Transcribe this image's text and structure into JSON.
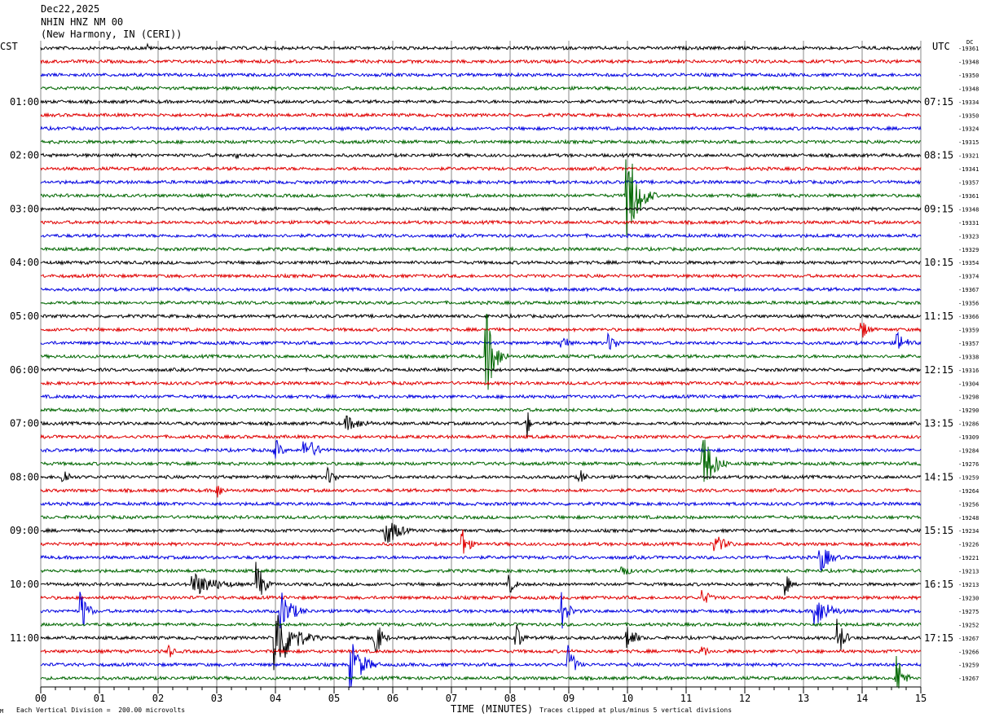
{
  "header": {
    "date": "Dec22,2025",
    "station": "NHIN HNZ NM 00",
    "location": "(New Harmony, IN (CERI))"
  },
  "labels": {
    "left_tz": "CST",
    "right_tz": "UTC",
    "dc_label": "DC",
    "xlabel": "TIME (MINUTES)",
    "scale_note": "Each Vertical Division =  200.00 microvolts",
    "clip_note": "Traces clipped at plus/minus 5 vertical divisions",
    "corner_mark": "M"
  },
  "chart_data": {
    "type": "line",
    "xlabel": "TIME (MINUTES)",
    "xlim": [
      0,
      15
    ],
    "x_ticks": [
      "00",
      "01",
      "02",
      "03",
      "04",
      "05",
      "06",
      "07",
      "08",
      "09",
      "10",
      "11",
      "12",
      "13",
      "14",
      "15"
    ],
    "trace_colors": [
      "#000000",
      "#e00000",
      "#0000e0",
      "#006600"
    ],
    "row_count": 48,
    "cst_labels": [
      "01:00",
      "02:00",
      "03:00",
      "04:00",
      "05:00",
      "06:00",
      "07:00",
      "08:00",
      "09:00",
      "10:00",
      "11:00"
    ],
    "utc_labels": [
      "07:15",
      "08:15",
      "09:15",
      "10:15",
      "11:15",
      "12:15",
      "13:15",
      "14:15",
      "15:15",
      "16:15",
      "17:15"
    ],
    "dc_offsets": [
      "-19361",
      "-19348",
      "-19350",
      "-19348",
      "-19334",
      "-19350",
      "-19324",
      "-19315",
      "-19321",
      "-19341",
      "-19357",
      "-19361",
      "-19348",
      "-19331",
      "-19323",
      "-19329",
      "-19354",
      "-19374",
      "-19367",
      "-19356",
      "-19366",
      "-19359",
      "-19357",
      "-19338",
      "-19316",
      "-19304",
      "-19298",
      "-19290",
      "-19286",
      "-19309",
      "-19284",
      "-19276",
      "-19259",
      "-19264",
      "-19256",
      "-19248",
      "-19234",
      "-19226",
      "-19221",
      "-19213",
      "-19213",
      "-19230",
      "-19275",
      "-19252",
      "-19267",
      "-19266",
      "-19259",
      "-19267"
    ],
    "events": [
      {
        "row": 0,
        "minute": 1.85,
        "amp": 6,
        "dur": 0.1
      },
      {
        "row": 8,
        "minute": 3.35,
        "amp": 6,
        "dur": 0.1
      },
      {
        "row": 11,
        "minute": 10.0,
        "amp": 70,
        "dur": 0.5
      },
      {
        "row": 21,
        "minute": 14.0,
        "amp": 12,
        "dur": 0.4
      },
      {
        "row": 22,
        "minute": 8.9,
        "amp": 12,
        "dur": 0.3
      },
      {
        "row": 22,
        "minute": 9.7,
        "amp": 12,
        "dur": 0.4
      },
      {
        "row": 22,
        "minute": 14.6,
        "amp": 14,
        "dur": 0.5
      },
      {
        "row": 23,
        "minute": 7.6,
        "amp": 55,
        "dur": 0.4
      },
      {
        "row": 28,
        "minute": 5.2,
        "amp": 10,
        "dur": 1.0
      },
      {
        "row": 28,
        "minute": 8.3,
        "amp": 20,
        "dur": 0.1
      },
      {
        "row": 30,
        "minute": 4.0,
        "amp": 16,
        "dur": 0.3
      },
      {
        "row": 30,
        "minute": 4.5,
        "amp": 18,
        "dur": 0.6
      },
      {
        "row": 31,
        "minute": 11.3,
        "amp": 40,
        "dur": 0.5
      },
      {
        "row": 32,
        "minute": 0.4,
        "amp": 12,
        "dur": 0.3
      },
      {
        "row": 32,
        "minute": 4.9,
        "amp": 12,
        "dur": 0.4
      },
      {
        "row": 32,
        "minute": 9.2,
        "amp": 10,
        "dur": 0.3
      },
      {
        "row": 33,
        "minute": 3.0,
        "amp": 12,
        "dur": 0.3
      },
      {
        "row": 36,
        "minute": 5.9,
        "amp": 20,
        "dur": 0.6
      },
      {
        "row": 37,
        "minute": 7.2,
        "amp": 20,
        "dur": 0.3
      },
      {
        "row": 37,
        "minute": 11.5,
        "amp": 12,
        "dur": 0.6
      },
      {
        "row": 38,
        "minute": 13.3,
        "amp": 18,
        "dur": 0.5
      },
      {
        "row": 39,
        "minute": 9.9,
        "amp": 10,
        "dur": 0.4
      },
      {
        "row": 40,
        "minute": 2.6,
        "amp": 16,
        "dur": 1.2
      },
      {
        "row": 40,
        "minute": 3.7,
        "amp": 30,
        "dur": 0.3
      },
      {
        "row": 40,
        "minute": 8.0,
        "amp": 12,
        "dur": 0.3
      },
      {
        "row": 40,
        "minute": 12.7,
        "amp": 16,
        "dur": 0.2
      },
      {
        "row": 41,
        "minute": 11.3,
        "amp": 10,
        "dur": 0.4
      },
      {
        "row": 42,
        "minute": 0.7,
        "amp": 28,
        "dur": 0.3
      },
      {
        "row": 42,
        "minute": 4.1,
        "amp": 25,
        "dur": 0.6
      },
      {
        "row": 42,
        "minute": 8.9,
        "amp": 25,
        "dur": 0.3
      },
      {
        "row": 42,
        "minute": 13.2,
        "amp": 22,
        "dur": 0.7
      },
      {
        "row": 44,
        "minute": 4.0,
        "amp": 50,
        "dur": 0.8
      },
      {
        "row": 44,
        "minute": 5.7,
        "amp": 30,
        "dur": 0.3
      },
      {
        "row": 44,
        "minute": 8.1,
        "amp": 20,
        "dur": 0.3
      },
      {
        "row": 44,
        "minute": 10.0,
        "amp": 18,
        "dur": 0.4
      },
      {
        "row": 44,
        "minute": 13.6,
        "amp": 25,
        "dur": 0.3
      },
      {
        "row": 45,
        "minute": 2.2,
        "amp": 10,
        "dur": 0.2
      },
      {
        "row": 45,
        "minute": 11.3,
        "amp": 8,
        "dur": 0.3
      },
      {
        "row": 46,
        "minute": 5.3,
        "amp": 30,
        "dur": 0.6
      },
      {
        "row": 46,
        "minute": 9.0,
        "amp": 25,
        "dur": 0.3
      },
      {
        "row": 47,
        "minute": 14.6,
        "amp": 30,
        "dur": 0.3
      }
    ]
  }
}
